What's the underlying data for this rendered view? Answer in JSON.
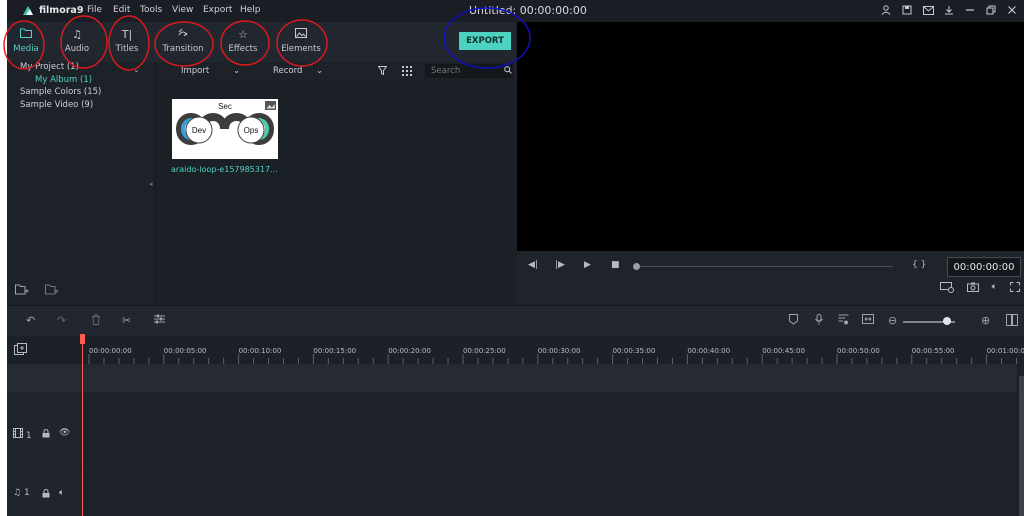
{
  "app": {
    "name": "filmora9",
    "document_title": "Untitled:",
    "document_time": "00:00:00:00"
  },
  "menu": [
    "File",
    "Edit",
    "Tools",
    "View",
    "Export",
    "Help"
  ],
  "window_icons": [
    "account-icon",
    "save-icon",
    "mail-icon",
    "download-icon",
    "minimize-icon",
    "restore-icon",
    "close-icon"
  ],
  "toolbar": {
    "tabs": [
      {
        "label": "Media",
        "icon": "folder-icon",
        "active": true
      },
      {
        "label": "Audio",
        "icon": "music-note-icon",
        "active": false
      },
      {
        "label": "Titles",
        "icon": "text-icon",
        "active": false
      },
      {
        "label": "Transition",
        "icon": "transition-icon",
        "active": false
      },
      {
        "label": "Effects",
        "icon": "effects-icon",
        "active": false
      },
      {
        "label": "Elements",
        "icon": "image-icon",
        "active": false
      }
    ],
    "export_label": "EXPORT"
  },
  "library": {
    "items": [
      {
        "label": "My Project (1)",
        "selected": false
      },
      {
        "label": "My Album (1)",
        "selected": true
      },
      {
        "label": "Sample Colors (15)",
        "selected": false
      },
      {
        "label": "Sample Video (9)",
        "selected": false
      }
    ]
  },
  "media": {
    "import_label": "Import",
    "record_label": "Record",
    "search_placeholder": "Search",
    "thumb_file_name": "araido-loop-e157985317...",
    "logo_text": {
      "top": "Sec",
      "left": "Dev",
      "right": "Ops"
    }
  },
  "preview": {
    "timecode": "00:00:00:00",
    "brackets": "{ }"
  },
  "timeline": {
    "ruler_ticks": [
      "00:00:00:00",
      "00:00:05:00",
      "00:00:10:00",
      "00:00:15:00",
      "00:00:20:00",
      "00:00:25:00",
      "00:00:30:00",
      "00:00:35:00",
      "00:00:40:00",
      "00:00:45:00",
      "00:00:50:00",
      "00:00:55:00",
      "00:01:00:00"
    ],
    "video_track_number": "1",
    "audio_track_number": "1"
  },
  "colors": {
    "accent": "#4bd2c1",
    "playhead": "#ff5a4f",
    "annotation_red": "#e0191e",
    "annotation_blue": "#1010c8"
  }
}
